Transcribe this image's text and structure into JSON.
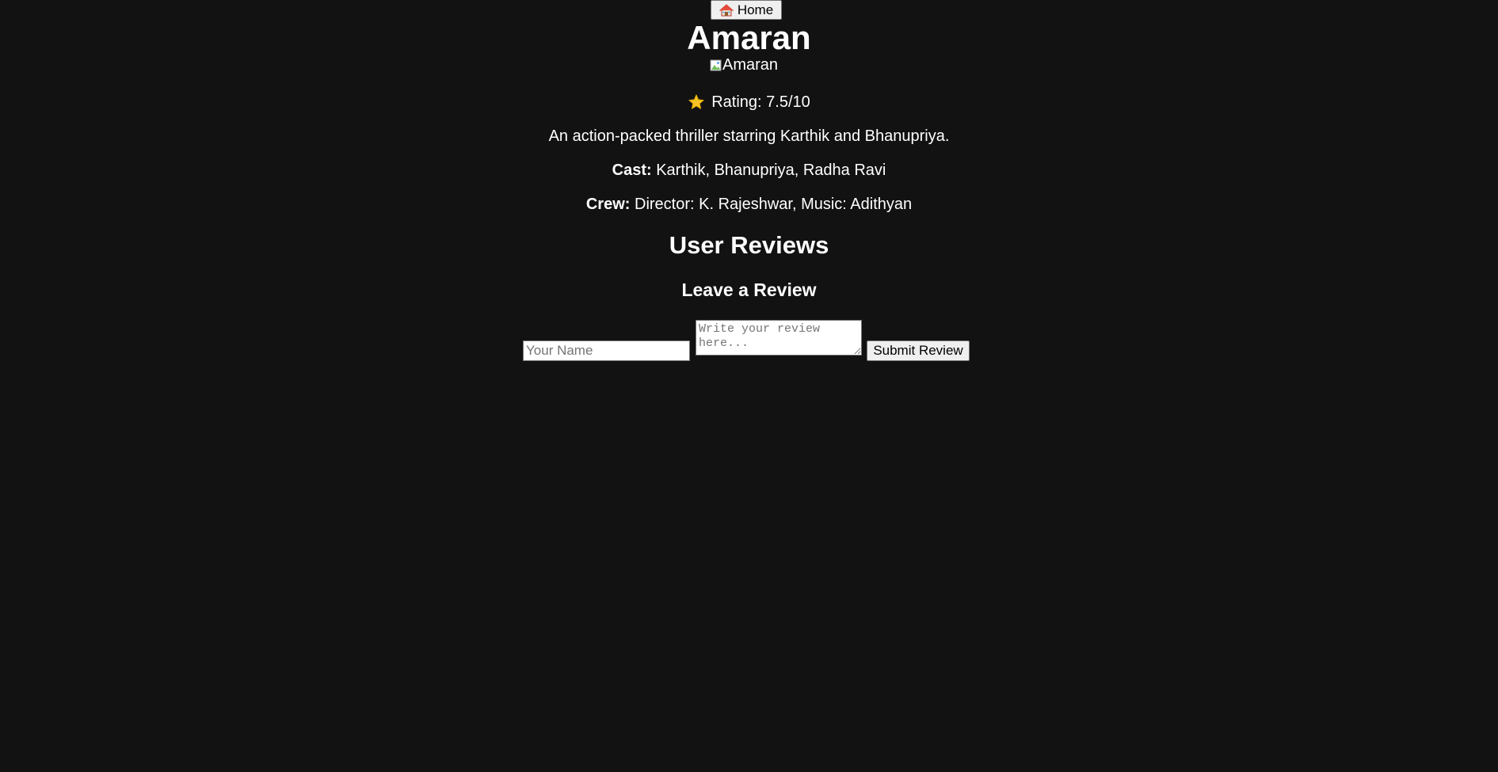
{
  "nav": {
    "home_icon": "house-icon",
    "home_label": "Home"
  },
  "movie": {
    "title": "Amaran",
    "poster_alt": "Amaran",
    "rating_icon": "star-icon",
    "rating_text": "Rating: 7.5/10",
    "description": "An action-packed thriller starring Karthik and Bhanupriya.",
    "cast_label": "Cast:",
    "cast_value": "Karthik, Bhanupriya, Radha Ravi",
    "crew_label": "Crew:",
    "crew_value": "Director: K. Rajeshwar, Music: Adithyan"
  },
  "reviews": {
    "heading": "User Reviews",
    "form_heading": "Leave a Review",
    "name_placeholder": "Your Name",
    "review_placeholder": "Write your review here...",
    "submit_label": "Submit Review"
  },
  "colors": {
    "background": "#121212",
    "text": "#ffffff",
    "star": "#f7c325"
  }
}
